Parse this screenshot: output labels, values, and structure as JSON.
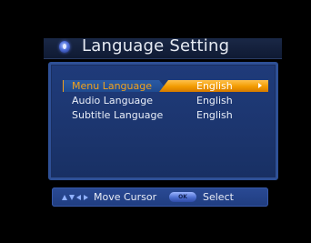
{
  "header": {
    "title": "Language Setting",
    "icon": "disc-icon"
  },
  "menu": {
    "items": [
      {
        "label": "Menu Language",
        "value": "English",
        "selected": true,
        "has_arrow": true
      },
      {
        "label": "Audio Language",
        "value": "English",
        "selected": false
      },
      {
        "label": "Subtitle Language",
        "value": "English",
        "selected": false
      }
    ]
  },
  "help": {
    "move_label": "Move Cursor",
    "ok_key": "OK",
    "select_label": "Select",
    "nav_icon": "arrow-keys-icon"
  },
  "colors": {
    "background": "#000000",
    "panel": "#1f3b7a",
    "panel_border": "#2e5096",
    "highlight": "#f29b00",
    "title_bar": "#152340"
  }
}
